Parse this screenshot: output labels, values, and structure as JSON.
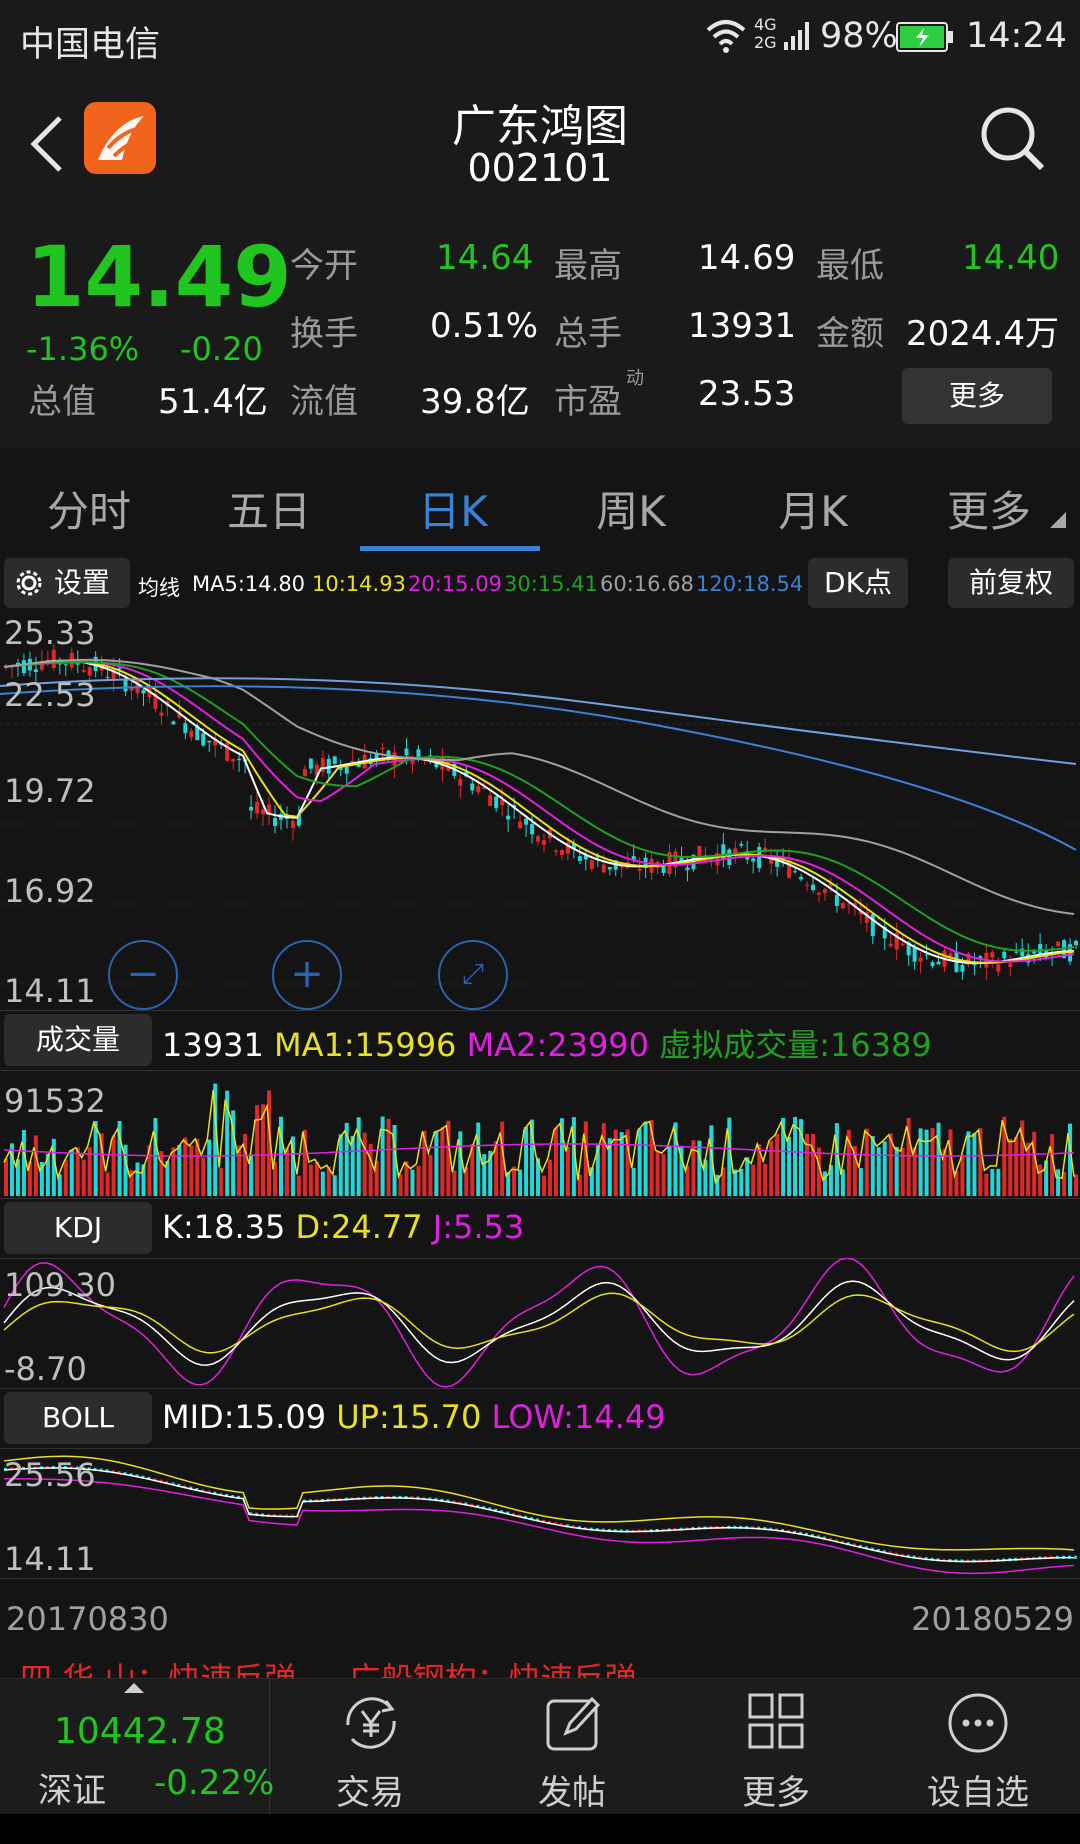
{
  "status_bar": {
    "carrier": "中国电信",
    "network": "4G 2G",
    "battery": "98%",
    "time": "14:24"
  },
  "header": {
    "stock_name": "广东鸿图",
    "stock_code": "002101"
  },
  "quote": {
    "price": "14.49",
    "change_pct": "-1.36%",
    "change_amt": "-0.20",
    "total_value_label": "总值",
    "total_value": "51.4亿",
    "open_label": "今开",
    "open": "14.64",
    "high_label": "最高",
    "high": "14.69",
    "low_label": "最低",
    "low": "14.40",
    "turnover_label": "换手",
    "turnover": "0.51%",
    "volume_label": "总手",
    "volume": "13931",
    "amount_label": "金额",
    "amount": "2024.4万",
    "float_label": "流值",
    "float": "39.8亿",
    "pe_label": "市盈",
    "pe_sup": "动",
    "pe": "23.53",
    "more_button": "更多"
  },
  "tabs": [
    {
      "label": "分时"
    },
    {
      "label": "五日"
    },
    {
      "label": "日K",
      "active": true
    },
    {
      "label": "周K"
    },
    {
      "label": "月K"
    },
    {
      "label": "更多"
    }
  ],
  "ma_bar": {
    "settings": "设置",
    "title": "均线",
    "ma5": "MA5:14.80",
    "ma10": "10:14.93",
    "ma20": "20:15.09",
    "ma30": "30:15.41",
    "ma60": "60:16.68",
    "ma120": "120:18.54",
    "dk_button": "DK点",
    "adjust_button": "前复权"
  },
  "kline_axis": [
    "25.33",
    "22.53",
    "19.72",
    "16.92",
    "14.11"
  ],
  "volume": {
    "label": "成交量",
    "value": "13931",
    "ma1": "MA1:15996",
    "ma2": "MA2:23990",
    "virtual": "虚拟成交量:16389",
    "axis_top": "91532"
  },
  "kdj": {
    "label": "KDJ",
    "k": "K:18.35",
    "d": "D:24.77",
    "j": "J:5.53",
    "axis_top": "109.30",
    "axis_bottom": "-8.70"
  },
  "boll": {
    "label": "BOLL",
    "mid": "MID:15.09",
    "up": "UP:15.70",
    "low": "LOW:14.49",
    "axis_top": "25.56",
    "axis_bottom": "14.11"
  },
  "date_range": {
    "start": "20170830",
    "end": "20180529"
  },
  "ticker": "四 华 山：快速反弹 … 广船钢构：快速反弹",
  "bottom_nav": {
    "index_value": "10442.78",
    "index_name": "深证",
    "index_change": "-0.22%",
    "items": [
      {
        "label": "交易"
      },
      {
        "label": "发帖"
      },
      {
        "label": "更多"
      },
      {
        "label": "设自选"
      }
    ]
  },
  "colors": {
    "up": "#e02828",
    "down": "#20d8d8",
    "green": "#20c520",
    "ma5": "#ffffff",
    "ma10": "#e8e020",
    "ma20": "#e020e0",
    "ma30": "#20a020",
    "ma60": "#a0a0a0",
    "ma120": "#3a82d6",
    "accent": "#3a82d6"
  }
}
